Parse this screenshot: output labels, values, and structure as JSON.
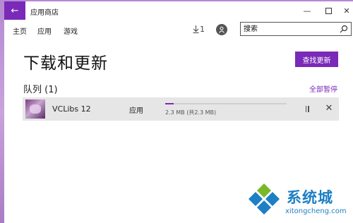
{
  "window": {
    "title": "应用商店",
    "back_icon": "arrow-left-icon",
    "controls": [
      "minimize-icon",
      "maximize-icon",
      "close-icon"
    ]
  },
  "nav": {
    "items": [
      {
        "label": "主页"
      },
      {
        "label": "应用"
      },
      {
        "label": "游戏"
      }
    ],
    "downloads_count": "1",
    "search_placeholder": "搜索"
  },
  "page": {
    "title": "下载和更新",
    "check_updates_label": "查找更新",
    "queue_label": "队列 (1)",
    "pause_all_label": "全部暂停"
  },
  "downloads": [
    {
      "name": "VCLibs 12",
      "type": "应用",
      "size_text": "2.3 MB (共2.3 MB)",
      "progress": 0.07
    }
  ],
  "watermark": {
    "brand": "系统城",
    "url": "xitongcheng.com"
  },
  "colors": {
    "accent": "#7a2ab8",
    "watermark_blue": "#1d7fc4",
    "watermark_green": "#7ab82a"
  }
}
